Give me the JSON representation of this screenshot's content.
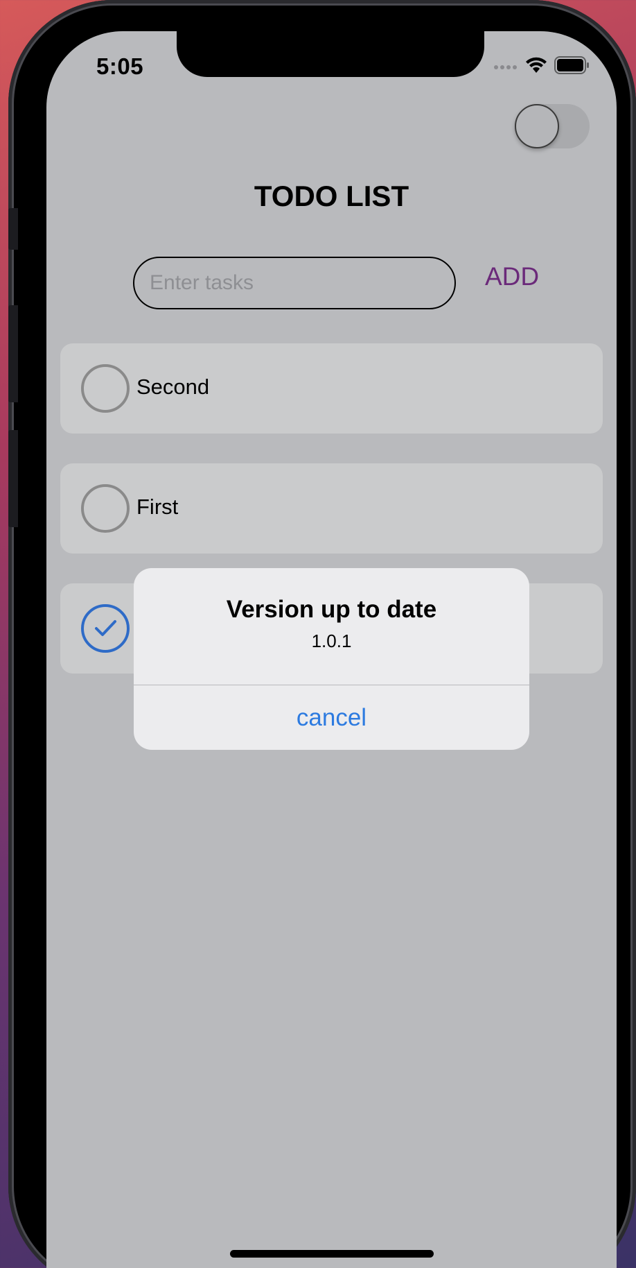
{
  "status_bar": {
    "time": "5:05",
    "icons": [
      "cellular-signal-icon",
      "wifi-icon",
      "battery-icon"
    ]
  },
  "header": {
    "title": "TODO LIST",
    "theme_toggle": {
      "on": false
    }
  },
  "task_entry": {
    "placeholder": "Enter tasks",
    "value": "",
    "add_label": "ADD",
    "add_color": "#6b2a7a"
  },
  "todos": [
    {
      "label": "Second",
      "completed": false
    },
    {
      "label": "First",
      "completed": false
    },
    {
      "label": "",
      "completed": true
    }
  ],
  "alert": {
    "title": "Version up to date",
    "message": "1.0.1",
    "cancel_label": "cancel",
    "button_color": "#2d7be0"
  },
  "colors": {
    "screen_background": "#b9babd",
    "check_done": "#2e6bc7"
  }
}
